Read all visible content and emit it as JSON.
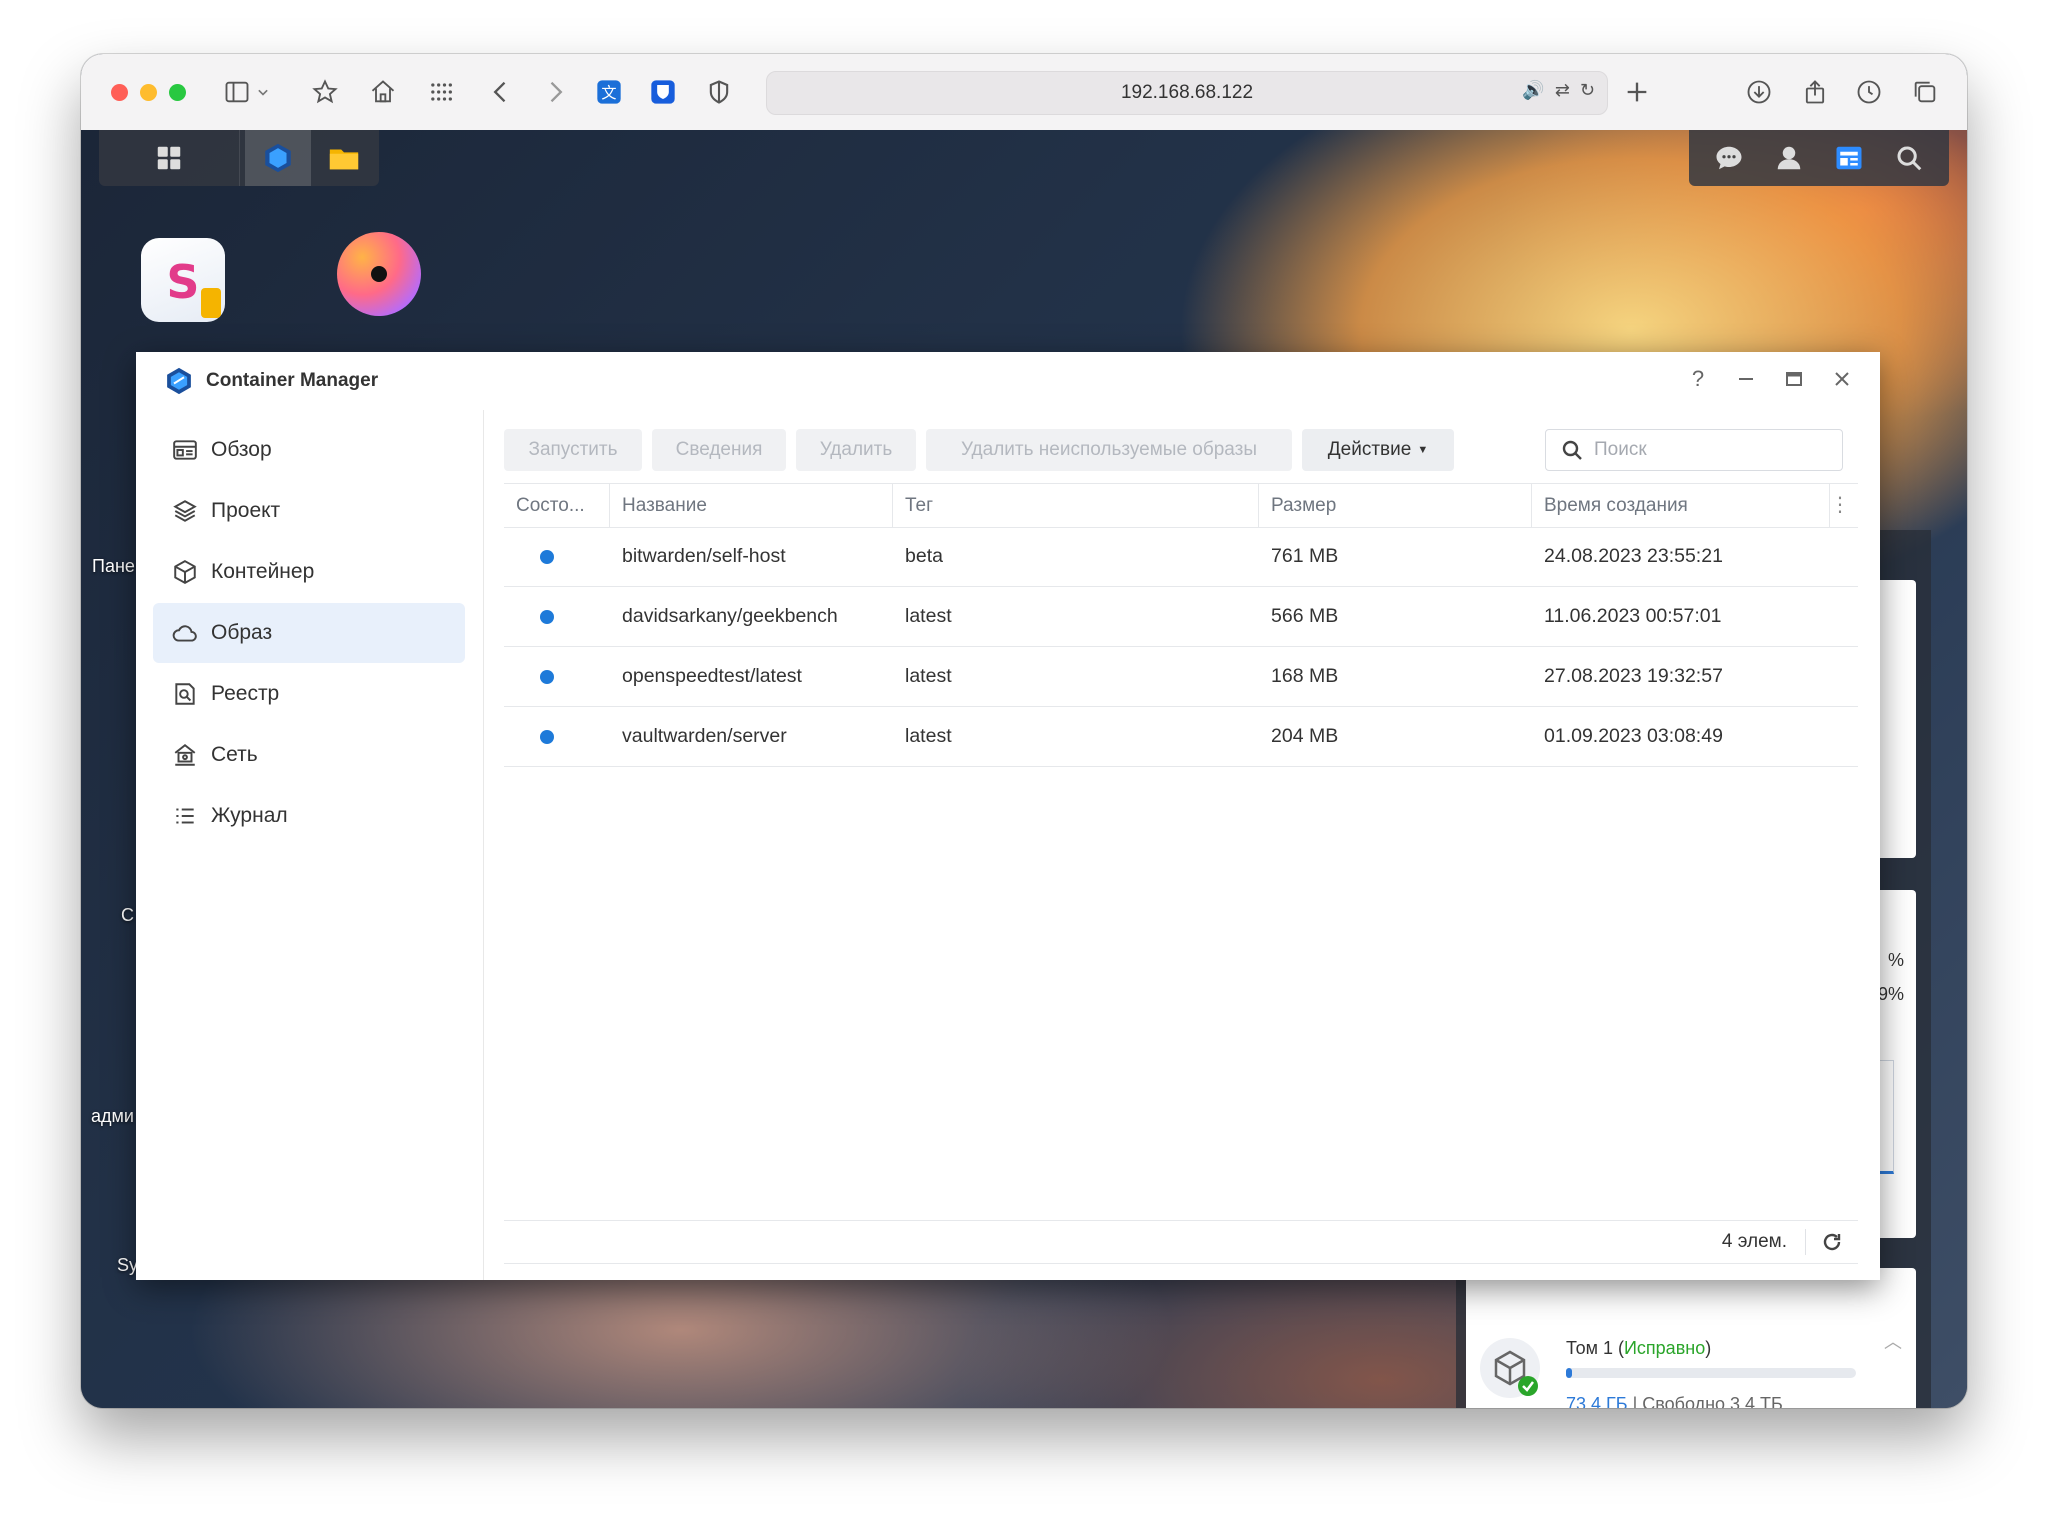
{
  "browser": {
    "url": "192.168.68.122",
    "icons": [
      "sidebar-icon",
      "chevron-down-icon",
      "star-icon",
      "home-icon",
      "grid-icon",
      "back-icon",
      "forward-icon",
      "translate-ext-icon",
      "bitwarden-ext-icon",
      "shield-icon",
      "speaker-icon",
      "translate-icon",
      "reload-icon",
      "plus-icon",
      "download-icon",
      "share-icon",
      "history-icon",
      "tabs-icon"
    ]
  },
  "desktop": {
    "labels": [
      "Пане",
      "C",
      "адми",
      "Sy"
    ]
  },
  "widgets": {
    "pct1": "%",
    "pct2": "9%",
    "volume_title": "Том 1 (",
    "volume_status": "Исправно",
    "volume_close": ")",
    "volume_used": "73.4 ГБ",
    "volume_sep": " | ",
    "volume_free": "Свободно 3.4 ТБ",
    "volume_usage_fraction": 0.02
  },
  "window": {
    "title": "Container Manager",
    "help": "?",
    "sidebar": [
      {
        "label": "Обзор",
        "icon": "overview-icon",
        "active": false
      },
      {
        "label": "Проект",
        "icon": "project-icon",
        "active": false
      },
      {
        "label": "Контейнер",
        "icon": "container-icon",
        "active": false
      },
      {
        "label": "Образ",
        "icon": "cloud-icon",
        "active": true
      },
      {
        "label": "Реестр",
        "icon": "registry-icon",
        "active": false
      },
      {
        "label": "Сеть",
        "icon": "network-icon",
        "active": false
      },
      {
        "label": "Журнал",
        "icon": "log-icon",
        "active": false
      }
    ],
    "toolbar": {
      "run": "Запустить",
      "details": "Сведения",
      "delete": "Удалить",
      "prune": "Удалить неиспользуемые образы",
      "action": "Действие",
      "search_placeholder": "Поиск"
    },
    "table": {
      "columns": [
        "Состо...",
        "Название",
        "Тег",
        "Размер",
        "Время создания"
      ],
      "rows": [
        {
          "name": "bitwarden/self-host",
          "tag": "beta",
          "size": "761 MB",
          "created": "24.08.2023 23:55:21"
        },
        {
          "name": "davidsarkany/geekbench",
          "tag": "latest",
          "size": "566 MB",
          "created": "11.06.2023 00:57:01"
        },
        {
          "name": "openspeedtest/latest",
          "tag": "latest",
          "size": "168 MB",
          "created": "27.08.2023 19:32:57"
        },
        {
          "name": "vaultwarden/server",
          "tag": "latest",
          "size": "204 MB",
          "created": "01.09.2023 03:08:49"
        }
      ],
      "count": "4 элем."
    }
  },
  "colors": {
    "accent": "#1e7ad9",
    "active_nav": "#e8f0fb",
    "healthy": "#2aa52a"
  }
}
